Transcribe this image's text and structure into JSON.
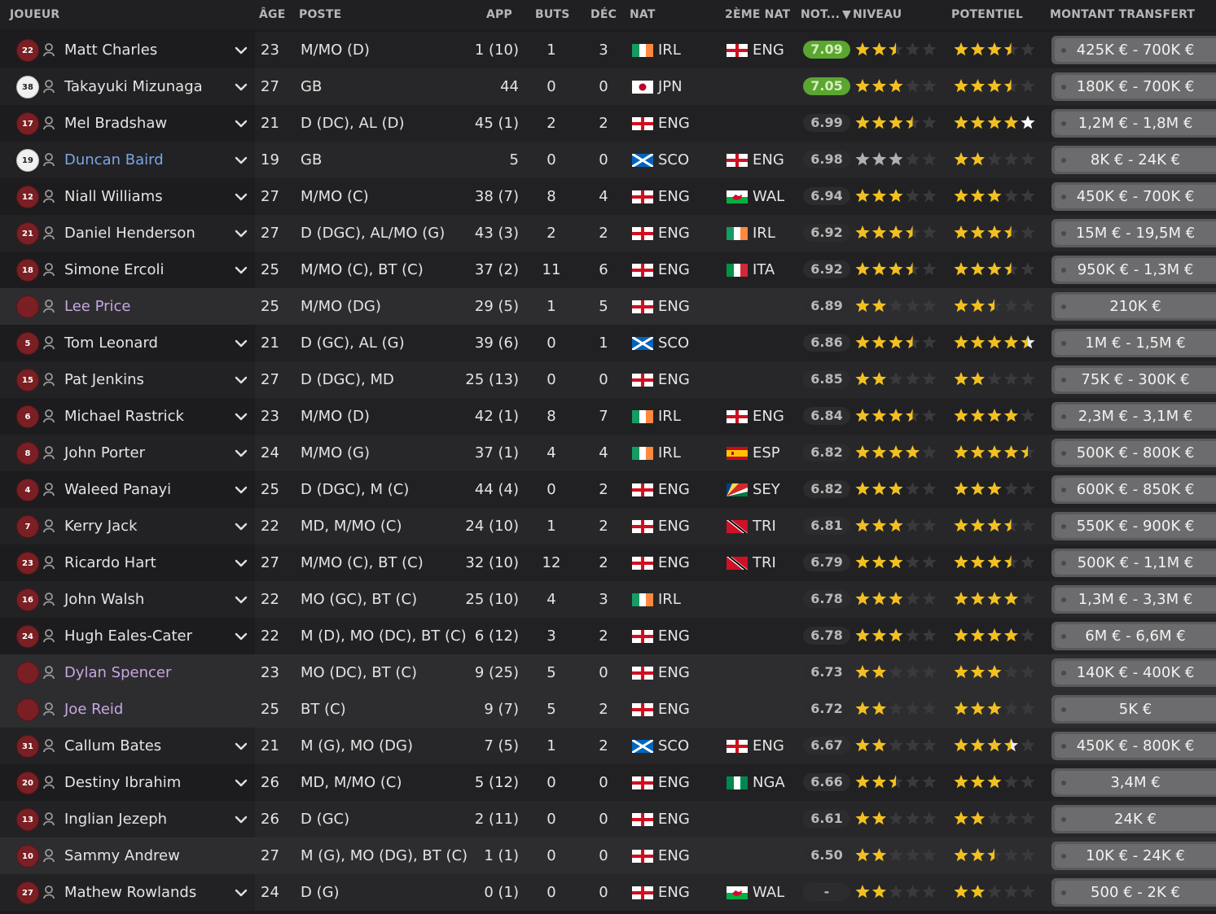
{
  "columns": {
    "player": "JOUEUR",
    "age": "ÂGE",
    "position": "POSTE",
    "apps": "APP",
    "goals": "BUTS",
    "assists": "DÉC",
    "nat": "NAT",
    "second_nat": "2ÈME NAT",
    "avg": "NOT...",
    "ability": "NIVEAU",
    "potential": "POTENTIEL",
    "transfer_value": "MONTANT TRANSFERT"
  },
  "sort_indicator": "▼",
  "colors": {
    "star_gold": "#f2c020",
    "star_silver": "#b0b0b0",
    "star_white": "#ffffff",
    "star_empty": "#3a3a3c",
    "avg_top": "#5aa630",
    "name_blue": "#7aa6e6",
    "name_purple": "#c8a6e0",
    "jersey_red": "#7a1f24"
  },
  "rows": [
    {
      "num": "22",
      "name": "Matt Charles",
      "age": "23",
      "pos": "M/MO (D)",
      "apps": "1 (10)",
      "gls": "1",
      "ast": "3",
      "nat": "IRL",
      "nat2": "ENG",
      "avg": "7.09",
      "ca": 2.5,
      "pa": 3.5,
      "val": "425K € - 700K €",
      "gk": false,
      "loan": false,
      "chev": true,
      "style": "",
      "top": true
    },
    {
      "num": "38",
      "name": "Takayuki Mizunaga",
      "age": "27",
      "pos": "GB",
      "apps": "44",
      "gls": "0",
      "ast": "0",
      "nat": "JPN",
      "nat2": "",
      "avg": "7.05",
      "ca": 3,
      "pa": 3.5,
      "val": "180K € - 700K €",
      "gk": true,
      "loan": false,
      "chev": true,
      "style": "",
      "top": true
    },
    {
      "num": "17",
      "name": "Mel Bradshaw",
      "age": "21",
      "pos": "D (DC), AL (D)",
      "apps": "45 (1)",
      "gls": "2",
      "ast": "2",
      "nat": "ENG",
      "nat2": "",
      "avg": "6.99",
      "ca": 3.5,
      "pa": 5,
      "val": "1,2M € - 1,8M €",
      "gk": false,
      "loan": false,
      "chev": true,
      "style": "",
      "top": false,
      "pa_white": true
    },
    {
      "num": "19",
      "name": "Duncan Baird",
      "age": "19",
      "pos": "GB",
      "apps": "5",
      "gls": "0",
      "ast": "0",
      "nat": "SCO",
      "nat2": "ENG",
      "avg": "6.98",
      "ca": 3,
      "pa": 2,
      "val": "8K € - 24K €",
      "gk": true,
      "loan": false,
      "chev": true,
      "style": "blue",
      "top": false,
      "silver": true
    },
    {
      "num": "12",
      "name": "Niall Williams",
      "age": "27",
      "pos": "M/MO (C)",
      "apps": "38 (7)",
      "gls": "8",
      "ast": "4",
      "nat": "ENG",
      "nat2": "WAL",
      "avg": "6.94",
      "ca": 3,
      "pa": 3,
      "val": "450K € - 700K €",
      "gk": false,
      "loan": false,
      "chev": true,
      "style": "",
      "top": false
    },
    {
      "num": "21",
      "name": "Daniel Henderson",
      "age": "27",
      "pos": "D (DGC), AL/MO (G)",
      "apps": "43 (3)",
      "gls": "2",
      "ast": "2",
      "nat": "ENG",
      "nat2": "IRL",
      "avg": "6.92",
      "ca": 3.5,
      "pa": 3.5,
      "val": "15M € - 19,5M €",
      "gk": false,
      "loan": false,
      "chev": true,
      "style": "",
      "top": false
    },
    {
      "num": "18",
      "name": "Simone Ercoli",
      "age": "25",
      "pos": "M/MO (C), BT (C)",
      "apps": "37 (2)",
      "gls": "11",
      "ast": "6",
      "nat": "ENG",
      "nat2": "ITA",
      "avg": "6.92",
      "ca": 3.5,
      "pa": 3.5,
      "val": "950K € - 1,3M €",
      "gk": false,
      "loan": false,
      "chev": true,
      "style": "",
      "top": false
    },
    {
      "num": "",
      "name": "Lee Price",
      "age": "25",
      "pos": "M/MO (DG)",
      "apps": "29 (5)",
      "gls": "1",
      "ast": "5",
      "nat": "ENG",
      "nat2": "",
      "avg": "6.89",
      "ca": 2,
      "pa": 2.5,
      "val": "210K €",
      "gk": false,
      "loan": true,
      "chev": false,
      "style": "purple",
      "top": false
    },
    {
      "num": "5",
      "name": "Tom Leonard",
      "age": "21",
      "pos": "D (GC), AL (G)",
      "apps": "39 (6)",
      "gls": "0",
      "ast": "1",
      "nat": "SCO",
      "nat2": "",
      "avg": "6.86",
      "ca": 3.5,
      "pa": 4.5,
      "val": "1M € - 1,5M €",
      "gk": false,
      "loan": false,
      "chev": true,
      "style": "",
      "top": false,
      "pa_white_half": true
    },
    {
      "num": "15",
      "name": "Pat Jenkins",
      "age": "27",
      "pos": "D (DGC), MD",
      "apps": "25 (13)",
      "gls": "0",
      "ast": "0",
      "nat": "ENG",
      "nat2": "",
      "avg": "6.85",
      "ca": 2,
      "pa": 2,
      "val": "75K € - 300K €",
      "gk": false,
      "loan": false,
      "chev": true,
      "style": "",
      "top": false
    },
    {
      "num": "6",
      "name": "Michael Rastrick",
      "age": "23",
      "pos": "M/MO (D)",
      "apps": "42 (1)",
      "gls": "8",
      "ast": "7",
      "nat": "IRL",
      "nat2": "ENG",
      "avg": "6.84",
      "ca": 3.5,
      "pa": 4,
      "val": "2,3M € - 3,1M €",
      "gk": false,
      "loan": false,
      "chev": true,
      "style": "",
      "top": false
    },
    {
      "num": "8",
      "name": "John Porter",
      "age": "24",
      "pos": "M/MO (G)",
      "apps": "37 (1)",
      "gls": "4",
      "ast": "4",
      "nat": "IRL",
      "nat2": "ESP",
      "avg": "6.82",
      "ca": 4,
      "pa": 4.5,
      "val": "500K € - 800K €",
      "gk": false,
      "loan": false,
      "chev": true,
      "style": "",
      "top": false
    },
    {
      "num": "4",
      "name": "Waleed Panayi",
      "age": "25",
      "pos": "D (DGC), M (C)",
      "apps": "44 (4)",
      "gls": "0",
      "ast": "2",
      "nat": "ENG",
      "nat2": "SEY",
      "avg": "6.82",
      "ca": 3,
      "pa": 3,
      "val": "600K € - 850K €",
      "gk": false,
      "loan": false,
      "chev": true,
      "style": "",
      "top": false
    },
    {
      "num": "7",
      "name": "Kerry Jack",
      "age": "22",
      "pos": "MD, M/MO (C)",
      "apps": "24 (10)",
      "gls": "1",
      "ast": "2",
      "nat": "ENG",
      "nat2": "TRI",
      "avg": "6.81",
      "ca": 3,
      "pa": 3.5,
      "val": "550K € - 900K €",
      "gk": false,
      "loan": false,
      "chev": true,
      "style": "",
      "top": false
    },
    {
      "num": "23",
      "name": "Ricardo Hart",
      "age": "27",
      "pos": "M/MO (C), BT (C)",
      "apps": "32 (10)",
      "gls": "12",
      "ast": "2",
      "nat": "ENG",
      "nat2": "TRI",
      "avg": "6.79",
      "ca": 3,
      "pa": 3.5,
      "val": "500K € - 1,1M €",
      "gk": false,
      "loan": false,
      "chev": true,
      "style": "",
      "top": false
    },
    {
      "num": "16",
      "name": "John Walsh",
      "age": "22",
      "pos": "MO (GC), BT (C)",
      "apps": "25 (10)",
      "gls": "4",
      "ast": "3",
      "nat": "IRL",
      "nat2": "",
      "avg": "6.78",
      "ca": 3,
      "pa": 4,
      "val": "1,3M € - 3,3M €",
      "gk": false,
      "loan": false,
      "chev": true,
      "style": "",
      "top": false
    },
    {
      "num": "24",
      "name": "Hugh Eales-Cater",
      "age": "22",
      "pos": "M (D), MO (DC), BT (C)",
      "apps": "6 (12)",
      "gls": "3",
      "ast": "2",
      "nat": "ENG",
      "nat2": "",
      "avg": "6.78",
      "ca": 3,
      "pa": 4,
      "val": "6M € - 6,6M €",
      "gk": false,
      "loan": false,
      "chev": true,
      "style": "",
      "top": false
    },
    {
      "num": "",
      "name": "Dylan Spencer",
      "age": "23",
      "pos": "MO (DC), BT (C)",
      "apps": "9 (25)",
      "gls": "5",
      "ast": "0",
      "nat": "ENG",
      "nat2": "",
      "avg": "6.73",
      "ca": 2,
      "pa": 3,
      "val": "140K € - 400K €",
      "gk": false,
      "loan": true,
      "chev": false,
      "style": "purple",
      "top": false
    },
    {
      "num": "",
      "name": "Joe Reid",
      "age": "25",
      "pos": "BT (C)",
      "apps": "9 (7)",
      "gls": "5",
      "ast": "2",
      "nat": "ENG",
      "nat2": "",
      "avg": "6.72",
      "ca": 2,
      "pa": 3,
      "val": "5K €",
      "gk": false,
      "loan": true,
      "chev": false,
      "style": "purple",
      "top": false
    },
    {
      "num": "31",
      "name": "Callum Bates",
      "age": "21",
      "pos": "M (G), MO (DG)",
      "apps": "7 (5)",
      "gls": "1",
      "ast": "2",
      "nat": "SCO",
      "nat2": "ENG",
      "avg": "6.67",
      "ca": 2,
      "pa": 3.5,
      "val": "450K € - 800K €",
      "gk": false,
      "loan": false,
      "chev": true,
      "style": "",
      "top": false,
      "pa_white_half": true
    },
    {
      "num": "20",
      "name": "Destiny Ibrahim",
      "age": "26",
      "pos": "MD, M/MO (C)",
      "apps": "5 (12)",
      "gls": "0",
      "ast": "0",
      "nat": "ENG",
      "nat2": "NGA",
      "avg": "6.66",
      "ca": 2.5,
      "pa": 3,
      "val": "3,4M €",
      "gk": false,
      "loan": false,
      "chev": true,
      "style": "",
      "top": false
    },
    {
      "num": "13",
      "name": "Inglian Jezeph",
      "age": "26",
      "pos": "D (GC)",
      "apps": "2 (11)",
      "gls": "0",
      "ast": "0",
      "nat": "ENG",
      "nat2": "",
      "avg": "6.61",
      "ca": 2,
      "pa": 2,
      "val": "24K €",
      "gk": false,
      "loan": false,
      "chev": true,
      "style": "",
      "top": false
    },
    {
      "num": "10",
      "name": "Sammy Andrew",
      "age": "27",
      "pos": "M (G), MO (DG), BT (C)",
      "apps": "1 (1)",
      "gls": "0",
      "ast": "0",
      "nat": "ENG",
      "nat2": "",
      "avg": "6.50",
      "ca": 2,
      "pa": 2.5,
      "val": "10K € - 24K €",
      "gk": false,
      "loan": false,
      "chev": false,
      "style": "",
      "top": false
    },
    {
      "num": "27",
      "name": "Mathew Rowlands",
      "age": "24",
      "pos": "D (G)",
      "apps": "0 (1)",
      "gls": "0",
      "ast": "0",
      "nat": "ENG",
      "nat2": "WAL",
      "avg": "-",
      "ca": 2,
      "pa": 2,
      "val": "500 € - 2K €",
      "gk": false,
      "loan": false,
      "chev": true,
      "style": "",
      "top": false
    }
  ]
}
